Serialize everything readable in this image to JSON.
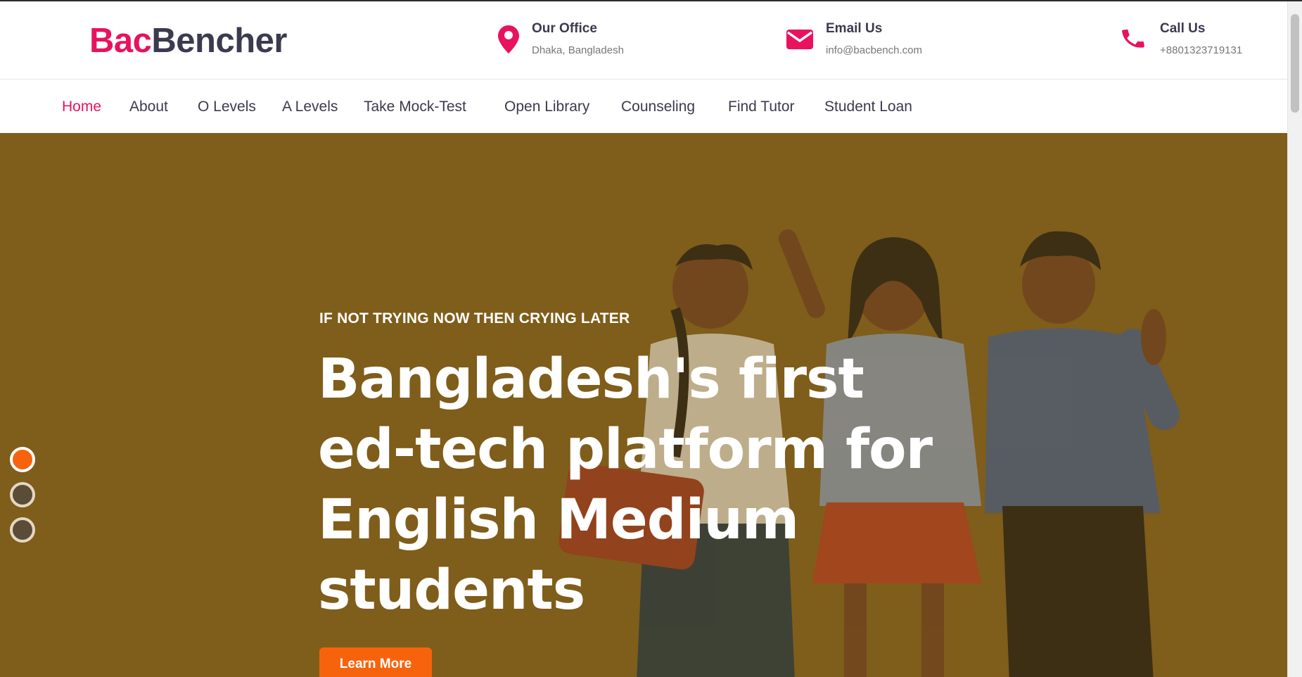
{
  "logo": {
    "part1": "Bac",
    "part2": "Bencher"
  },
  "contacts": [
    {
      "icon": "map-pin-icon",
      "title": "Our Office",
      "value": "Dhaka, Bangladesh"
    },
    {
      "icon": "envelope-icon",
      "title": "Email Us",
      "value": "info@bacbench.com"
    },
    {
      "icon": "phone-icon",
      "title": "Call Us",
      "value": "+8801323719131"
    }
  ],
  "nav": [
    {
      "label": "Home",
      "active": true
    },
    {
      "label": "About"
    },
    {
      "label": "O Levels"
    },
    {
      "label": "A Levels"
    },
    {
      "label": "Take Mock-Test"
    },
    {
      "label": "Open Library"
    },
    {
      "label": "Counseling"
    },
    {
      "label": "Find Tutor"
    },
    {
      "label": "Student Loan"
    }
  ],
  "hero": {
    "tagline": "IF NOT TRYING NOW THEN CRYING LATER",
    "headline_lines": [
      "Bangladesh's first",
      "ed-tech platform for",
      "English Medium",
      "students"
    ],
    "cta": "Learn More",
    "slide_count": 3,
    "active_slide": 1
  },
  "colors": {
    "brand_pink": "#e8125f",
    "brand_dark": "#3b3a4f",
    "hero_bg": "#7f5d1a",
    "cta_orange": "#f7630c"
  }
}
